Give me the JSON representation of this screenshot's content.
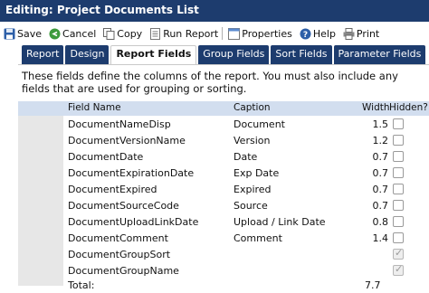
{
  "window": {
    "title": "Editing: Project Documents List"
  },
  "toolbar": {
    "save": "Save",
    "cancel": "Cancel",
    "copy": "Copy",
    "run_report": "Run Report",
    "properties": "Properties",
    "help": "Help",
    "print": "Print"
  },
  "tabs": [
    {
      "label": "Report",
      "active": false
    },
    {
      "label": "Design",
      "active": false
    },
    {
      "label": "Report Fields",
      "active": true
    },
    {
      "label": "Group Fields",
      "active": false
    },
    {
      "label": "Sort Fields",
      "active": false
    },
    {
      "label": "Parameter Fields",
      "active": false
    }
  ],
  "description": "These fields define the columns of the report. You must also include any fields that are used for grouping or sorting.",
  "columns": {
    "field_name": "Field Name",
    "caption": "Caption",
    "width": "Width",
    "hidden": "Hidden?"
  },
  "rows": [
    {
      "field": "DocumentNameDisp",
      "caption": "Document",
      "width": "1.5",
      "hidden": false
    },
    {
      "field": "DocumentVersionName",
      "caption": "Version",
      "width": "1.2",
      "hidden": false
    },
    {
      "field": "DocumentDate",
      "caption": "Date",
      "width": "0.7",
      "hidden": false
    },
    {
      "field": "DocumentExpirationDate",
      "caption": "Exp Date",
      "width": "0.7",
      "hidden": false
    },
    {
      "field": "DocumentExpired",
      "caption": "Expired",
      "width": "0.7",
      "hidden": false
    },
    {
      "field": "DocumentSourceCode",
      "caption": "Source",
      "width": "0.7",
      "hidden": false
    },
    {
      "field": "DocumentUploadLinkDate",
      "caption": "Upload / Link Date",
      "width": "0.8",
      "hidden": false
    },
    {
      "field": "DocumentComment",
      "caption": "Comment",
      "width": "1.4",
      "hidden": false
    },
    {
      "field": "DocumentGroupSort",
      "caption": "",
      "width": "",
      "hidden": true
    },
    {
      "field": "DocumentGroupName",
      "caption": "",
      "width": "",
      "hidden": true
    }
  ],
  "total": {
    "label": "Total:",
    "value": "7.7"
  },
  "colors": {
    "title_bar": "#1d3c6e",
    "header_row": "#d2deef",
    "tab_bg": "#1d3c6e"
  }
}
